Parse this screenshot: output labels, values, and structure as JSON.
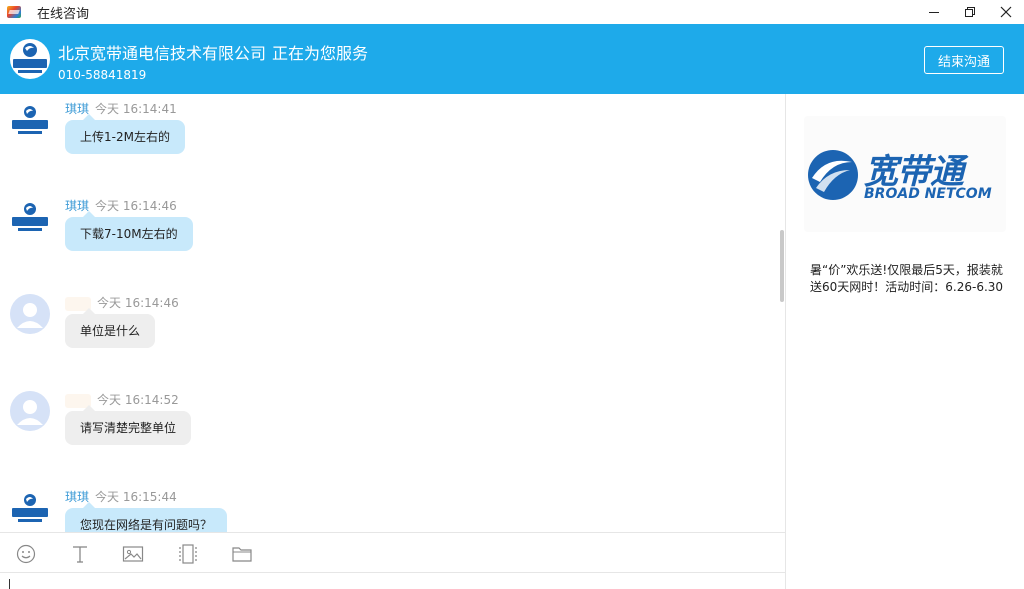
{
  "window": {
    "title": "在线咨询",
    "controls": [
      "minimize-icon",
      "restore-icon",
      "close-icon"
    ]
  },
  "header": {
    "company": "北京宽带通电信技术有限公司",
    "status": "正在为您服务",
    "phone": "010-58841819",
    "end_button": "结束沟通",
    "color": "#1eaaea"
  },
  "messages": [
    {
      "sender": "agent",
      "name": "琪琪",
      "time": "今天 16:14:41",
      "text": "上传1-2M左右的"
    },
    {
      "sender": "agent",
      "name": "琪琪",
      "time": "今天 16:14:46",
      "text": "下载7-10M左右的"
    },
    {
      "sender": "customer",
      "name": "",
      "time": "今天 16:14:46",
      "text": "单位是什么"
    },
    {
      "sender": "customer",
      "name": "",
      "time": "今天 16:14:52",
      "text": "请写清楚完整单位"
    },
    {
      "sender": "agent",
      "name": "琪琪",
      "time": "今天 16:15:44",
      "text": "您现在网络是有问题吗？"
    }
  ],
  "toolbar": {
    "tools": [
      "emoji-icon",
      "font-icon",
      "image-icon",
      "screenshot-icon",
      "folder-icon"
    ]
  },
  "side": {
    "brand_cn": "宽带通",
    "brand_en": "BROAD NETCOM",
    "promo": "暑“价”欢乐送!仅限最后5天，报装就送60天网时！活动时间：6.26-6.30"
  },
  "colors": {
    "agent_bubble": "#c8e9fb",
    "customer_bubble": "#eeeeee",
    "name": "#3d9bd6",
    "brand": "#1c64b2"
  }
}
